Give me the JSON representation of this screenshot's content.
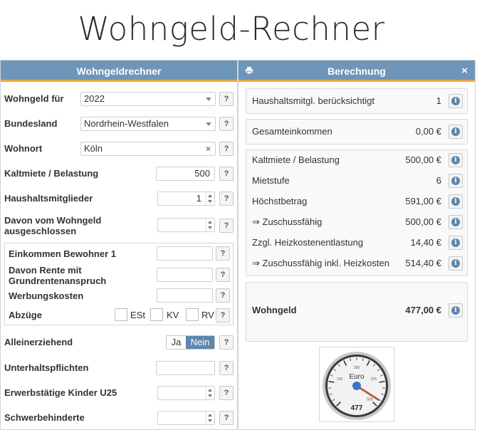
{
  "page_title": "Wohngeld-Rechner",
  "left_panel": {
    "title": "Wohngeldrechner",
    "wohngeld_fuer": {
      "label": "Wohngeld für",
      "value": "2022"
    },
    "bundesland": {
      "label": "Bundesland",
      "value": "Nordrhein-Westfalen"
    },
    "wohnort": {
      "label": "Wohnort",
      "value": "Köln",
      "clear": "×"
    },
    "kaltmiete": {
      "label": "Kaltmiete / Belastung",
      "value": "500"
    },
    "haushaltsmitglieder": {
      "label": "Haushaltsmitglieder",
      "value": "1"
    },
    "ausgeschlossen": {
      "label_line1": "Davon vom Wohngeld",
      "label_line2": "ausgeschlossen",
      "value": ""
    },
    "einkommen": {
      "label": "Einkommen Bewohner 1",
      "value": ""
    },
    "rente": {
      "label_line1": "Davon Rente mit",
      "label_line2": "Grundrentenanspruch",
      "value": ""
    },
    "werbungskosten": {
      "label": "Werbungskosten",
      "value": ""
    },
    "abzuege": {
      "label": "Abzüge",
      "options": [
        "ESt",
        "KV",
        "RV"
      ]
    },
    "alleinerziehend": {
      "label": "Alleinerziehend",
      "ja": "Ja",
      "nein": "Nein",
      "selected": "Nein"
    },
    "unterhalt": {
      "label": "Unterhaltspflichten",
      "value": ""
    },
    "kinder": {
      "label": "Erwerbstätige Kinder U25",
      "value": ""
    },
    "schwerbehinderte": {
      "label": "Schwerbehinderte",
      "value": ""
    },
    "help": "?"
  },
  "right_panel": {
    "title": "Berechnung",
    "close": "×",
    "info": "i",
    "haushalt": {
      "label": "Haushaltsmitgl. berücksichtigt",
      "value": "1"
    },
    "gesamteinkommen": {
      "label": "Gesamteinkommen",
      "value": "0,00 €"
    },
    "kaltmiete": {
      "label": "Kaltmiete / Belastung",
      "value": "500,00 €"
    },
    "mietstufe": {
      "label": "Mietstufe",
      "value": "6"
    },
    "hoechstbetrag": {
      "label": "Höchstbetrag",
      "value": "591,00 €"
    },
    "zuschussfaehig": {
      "label": "⇒ Zuschussfähig",
      "value": "500,00 €"
    },
    "heizkosten": {
      "label": "Zzgl. Heizkostenentlastung",
      "value": "14,40 €"
    },
    "zuschuss_inkl": {
      "label": "⇒ Zuschussfähig inkl. Heizkosten",
      "value": "514,40 €"
    },
    "wohngeld": {
      "label": "Wohngeld",
      "value": "477,00 €"
    }
  },
  "gauge": {
    "unit": "Euro",
    "value": 477,
    "value_label": "477",
    "max": 500,
    "ticks": [
      "125",
      "250",
      "375",
      "500"
    ]
  },
  "colors": {
    "header_bg": "#6f95b9",
    "header_accent": "#f0a83c",
    "toggle_active": "#5d87ad",
    "needle": "#b5653a",
    "gauge_center": "#3a75c4"
  }
}
